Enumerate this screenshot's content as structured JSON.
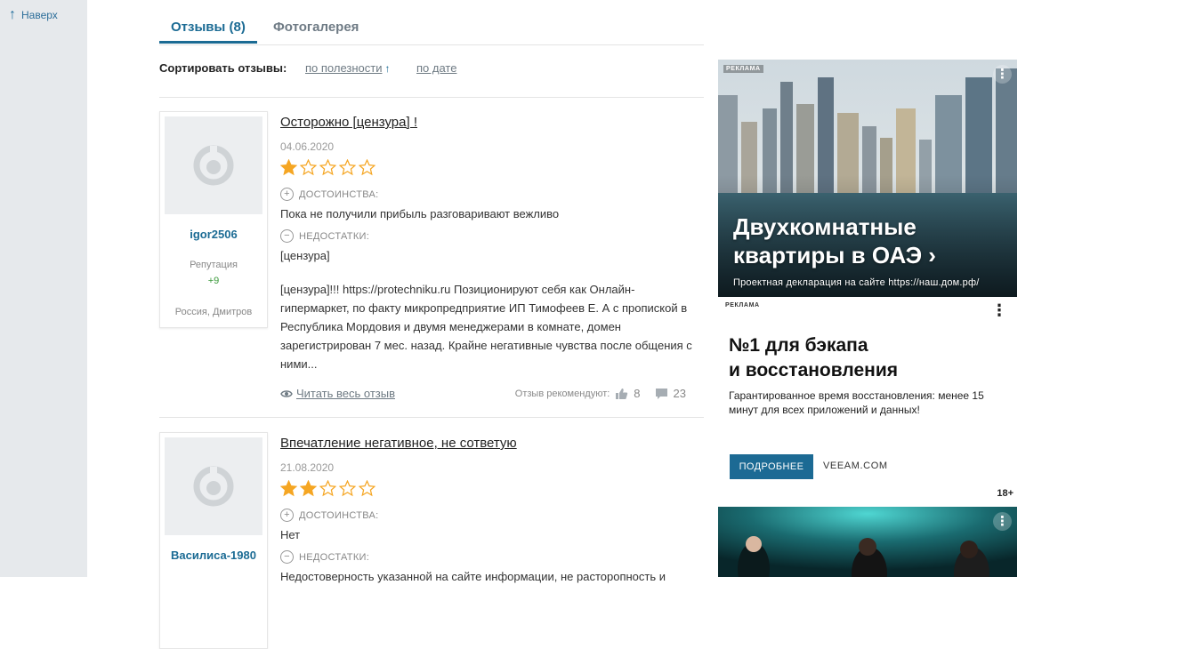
{
  "nav": {
    "back_to_top": "Наверх"
  },
  "tabs": [
    {
      "label": "Отзывы (8)",
      "active": true
    },
    {
      "label": "Фотогалерея",
      "active": false
    }
  ],
  "sort": {
    "label": "Сортировать отзывы:",
    "by_usefulness": "по полезности",
    "by_date": "по дате"
  },
  "reviews": [
    {
      "author": "igor2506",
      "reputation_label": "Репутация",
      "reputation": "+9",
      "location": "Россия, Дмитров",
      "title": "Осторожно [цензура] !",
      "date": "04.06.2020",
      "rating": 1,
      "rating_max": 5,
      "pros_label": "ДОСТОИНСТВА:",
      "pros": "Пока не получили прибыль разговаривают вежливо",
      "cons_label": "НЕДОСТАТКИ:",
      "cons": "[цензура]",
      "text": "[цензура]!!! https://protechniku.ru Позиционируют себя как Онлайн-гипермаркет, по факту микропредприятие ИП Тимофеев Е. А с пропиской в Республика Мордовия и двумя менеджерами в комнате, домен зарегистрирован 7 мес. назад. Крайне негативные чувства после общения с ними...",
      "read_more": "Читать весь отзыв",
      "recommend_label": "Отзыв рекомендуют:",
      "likes": "8",
      "comments": "23"
    },
    {
      "author": "Василиса-1980",
      "title": "Впечатление негативное, не сответую",
      "date": "21.08.2020",
      "rating": 2,
      "rating_max": 5,
      "pros_label": "ДОСТОИНСТВА:",
      "pros": "Нет",
      "cons_label": "НЕДОСТАТКИ:",
      "cons": "Недостоверность указанной на сайте информации, не расторопность и"
    }
  ],
  "ads": [
    {
      "tag": "РЕКЛАМА",
      "headline_line1": "Двухкомнатные",
      "headline_line2": "квартиры в ОАЭ ›",
      "sub": "Проектная декларация на сайте https://наш.дом.рф/"
    },
    {
      "tag": "РЕКЛАМА",
      "title_line1": "№1 для бэкапа",
      "title_line2": "и восстановления",
      "text": "Гарантированное время восстановления: менее 15 минут для всех приложений и данных!",
      "button": "ПОДРОБНЕЕ",
      "domain": "VEEAM.COM",
      "age": "18+"
    }
  ],
  "colors": {
    "accent": "#1b6b94",
    "star": "#f5a623",
    "rail": "#e6e9ec",
    "cta": "#1c6a94"
  }
}
